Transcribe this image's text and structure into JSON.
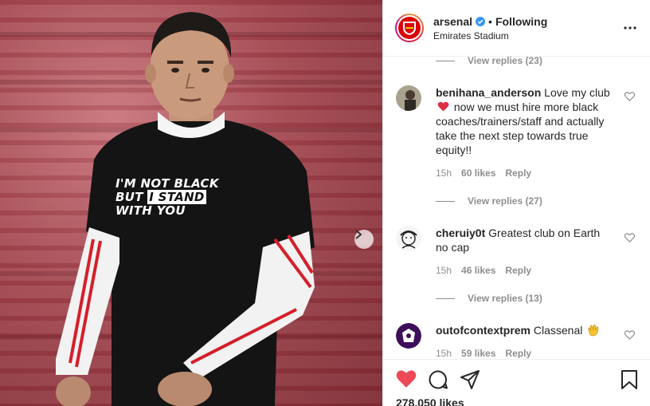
{
  "post": {
    "shirt_text": [
      "I'M NOT BLACK",
      "BUT",
      "I STAND",
      "WITH YOU"
    ]
  },
  "header": {
    "username": "arsenal",
    "dot": "•",
    "following": "Following",
    "location": "Emirates Stadium"
  },
  "comments": {
    "view_replies": [
      "View replies (23)",
      "View replies (27)",
      "View replies (13)"
    ],
    "items": [
      {
        "username": "benihana_anderson",
        "text_before_emoji": "Love my club",
        "emoji": "red-heart",
        "text_after_emoji": "now we must hire more black coaches/trainers/staff and actually take the next step towards true equity!!",
        "time": "15h",
        "likes": "60 likes",
        "reply": "Reply"
      },
      {
        "username": "cheruiy0t",
        "text": "Greatest club on Earth no cap",
        "time": "15h",
        "likes": "46 likes",
        "reply": "Reply"
      },
      {
        "username": "outofcontextprem",
        "text": "Classenal",
        "emoji": "clapping-hands",
        "time": "15h",
        "likes": "59 likes",
        "reply": "Reply"
      }
    ]
  },
  "footer": {
    "likes": "278,050 likes"
  },
  "colors": {
    "like_red": "#ed4956",
    "verified_blue": "#3897f0",
    "muted": "#8e8e8e",
    "arsenal_red": "#db0007"
  }
}
